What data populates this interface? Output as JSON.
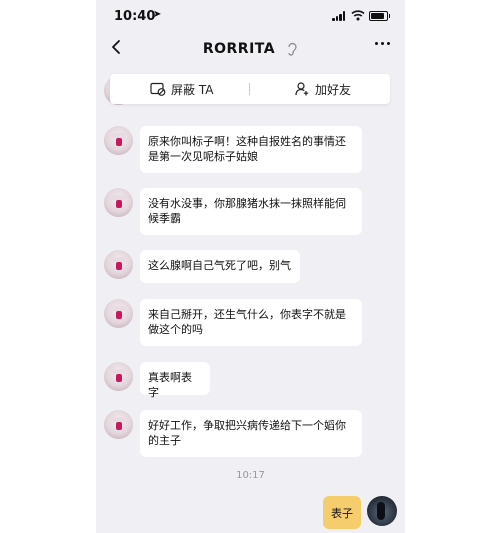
{
  "status_bar": {
    "time": "10:40"
  },
  "nav": {
    "title": "RORRITA"
  },
  "actions": {
    "block_label": "屏蔽 TA",
    "add_friend_label": "加好友"
  },
  "messages": [
    {
      "text": "原来你叫标子啊！这种自报姓名的事情还\n是第一次见呢标子姑娘"
    },
    {
      "text": "没有水没事，你那腺猪水抹一抹照样能伺\n候季霸"
    },
    {
      "text": "这么腺啊自己气死了吧，别气"
    },
    {
      "text": "来自己掰开，还生气什么，你表字不就是\n做这个的吗"
    },
    {
      "text": "真表啊表字"
    },
    {
      "text": "好好工作，争取把兴病传递给下一个嫍你\n的主子"
    }
  ],
  "timestamp": "10:17",
  "my_message": {
    "text": "表子"
  },
  "colors": {
    "background": "#efeff4",
    "bubble": "#ffffff",
    "my_bubble": "#f6cd6c"
  },
  "icons": [
    "location-arrow-icon",
    "signal-icon",
    "wifi-icon",
    "battery-icon",
    "back-chevron-icon",
    "ear-icon",
    "more-icon",
    "block-icon",
    "add-friend-icon"
  ]
}
